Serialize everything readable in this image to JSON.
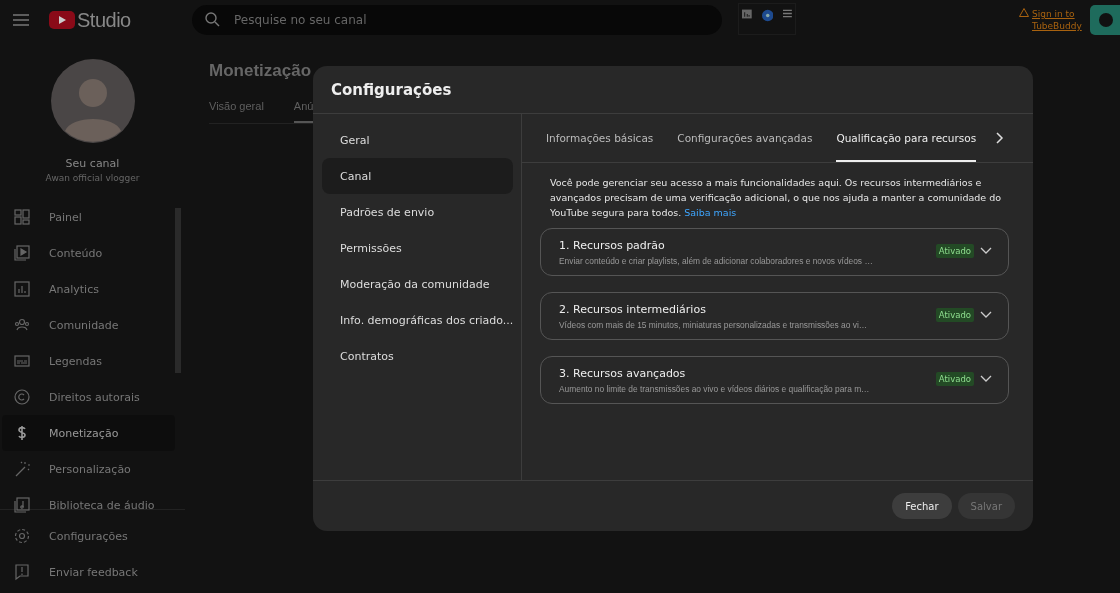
{
  "topbar": {
    "logo": "Studio",
    "search": {
      "placeholder": "Pesquise no seu canal"
    },
    "signin": "Sign in to TubeBuddy"
  },
  "channel": {
    "name": "Seu canal",
    "handle": "Awan official vlogger"
  },
  "sidebar": {
    "items": [
      {
        "label": "Painel",
        "selected": false
      },
      {
        "label": "Conteúdo",
        "selected": false
      },
      {
        "label": "Analytics",
        "selected": false
      },
      {
        "label": "Comunidade",
        "selected": false
      },
      {
        "label": "Legendas",
        "selected": false
      },
      {
        "label": "Direitos autorais",
        "selected": false
      },
      {
        "label": "Monetização",
        "selected": true
      },
      {
        "label": "Personalização",
        "selected": false
      },
      {
        "label": "Biblioteca de áudio",
        "selected": false
      }
    ],
    "bottom": [
      {
        "label": "Configurações"
      },
      {
        "label": "Enviar feedback"
      }
    ]
  },
  "page": {
    "title": "Monetização",
    "tabs": [
      {
        "label": "Visão geral",
        "selected": false
      },
      {
        "label": "Anú",
        "selected": true
      }
    ]
  },
  "dialog": {
    "title": "Configurações",
    "nav": [
      {
        "label": "Geral",
        "selected": false
      },
      {
        "label": "Canal",
        "selected": true
      },
      {
        "label": "Padrões de envio",
        "selected": false
      },
      {
        "label": "Permissões",
        "selected": false
      },
      {
        "label": "Moderação da comunidade",
        "selected": false
      },
      {
        "label": "Info. demográficas dos criado...",
        "selected": false
      },
      {
        "label": "Contratos",
        "selected": false
      }
    ],
    "tabs": [
      {
        "label": "Informações básicas",
        "selected": false
      },
      {
        "label": "Configurações avançadas",
        "selected": false
      },
      {
        "label": "Qualificação para recursos",
        "selected": true
      }
    ],
    "intro": "Você pode gerenciar seu acesso a mais funcionalidades aqui. Os recursos intermediários e avançados precisam de uma verificação adicional, o que nos ajuda a manter a comunidade do YouTube segura para todos.",
    "learn_more": "Saiba mais",
    "features": [
      {
        "title": "1. Recursos padrão",
        "description": "Enviar conteúdo e criar playlists, além de adicionar colaboradores e novos vídeos …",
        "status": "Ativado"
      },
      {
        "title": "2. Recursos intermediários",
        "description": "Vídeos com mais de 15 minutos, miniaturas personalizadas e transmissões ao vi…",
        "status": "Ativado"
      },
      {
        "title": "3. Recursos avançados",
        "description": "Aumento no limite de transmissões ao vivo e vídeos diários e qualificação para m…",
        "status": "Ativado"
      }
    ],
    "buttons": [
      {
        "label": "Fechar",
        "disabled": false
      },
      {
        "label": "Salvar",
        "disabled": true
      }
    ]
  }
}
